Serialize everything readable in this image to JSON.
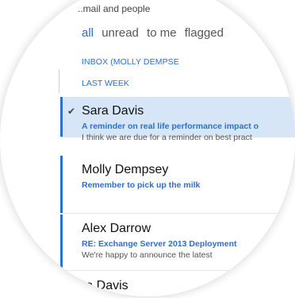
{
  "search": {
    "hint": "..mail and people"
  },
  "filters": [
    {
      "label": "all"
    },
    {
      "label": "unread"
    },
    {
      "label": "to me"
    },
    {
      "label": "flagged"
    }
  ],
  "folder": {
    "header": "INBOX (MOLLY DEMPSE"
  },
  "group": {
    "header": "LAST WEEK"
  },
  "messages": [
    {
      "sender": "Sara Davis",
      "subject": "A reminder on real life performance impact o",
      "preview": "I think we are due for a reminder on best pract",
      "selected": true
    },
    {
      "sender": "Molly Dempsey",
      "subject": "Remember to pick up the milk",
      "preview": ""
    },
    {
      "sender": "Alex Darrow",
      "subject": "RE: Exchange Server 2013 Deployment",
      "preview": "We're happy to announce the latest"
    },
    {
      "sender": "ra Davis"
    }
  ],
  "colors": {
    "accent": "#2a6fd6",
    "selected_bg": "#d6e6f7"
  },
  "icons": {
    "check": "check-icon"
  }
}
